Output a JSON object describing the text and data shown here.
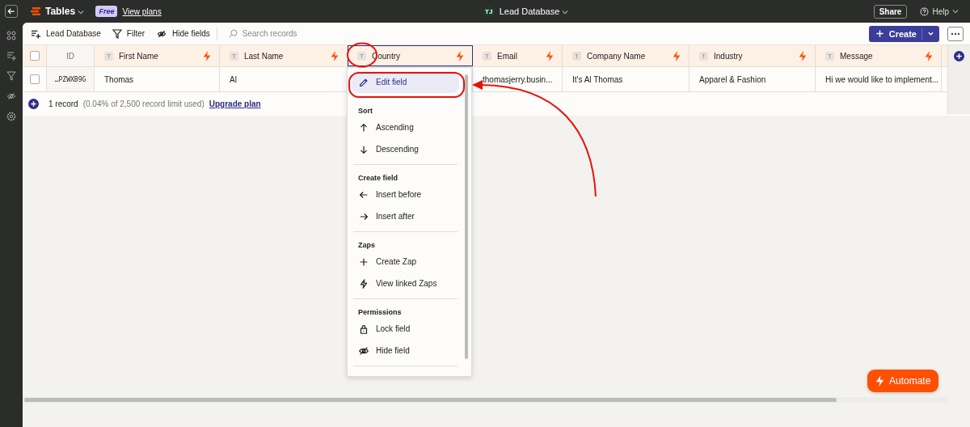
{
  "top_bar": {
    "app_name": "Tables",
    "plan_badge": "Free",
    "plan_link": "View plans",
    "avatar": "TJ",
    "table_name": "Lead Database",
    "share": "Share",
    "help": "Help"
  },
  "toolbar": {
    "table_button": "Lead Database",
    "filter": "Filter",
    "hide_fields": "Hide fields",
    "search": {
      "placeholder": "Search records"
    },
    "create": "Create"
  },
  "table": {
    "select_all_checked": false,
    "columns": [
      {
        "label": "ID",
        "kind": "id",
        "selected": false
      },
      {
        "label": "First Name",
        "kind": "text",
        "type_badge": "T",
        "selected": false
      },
      {
        "label": "Last Name",
        "kind": "text",
        "type_badge": "T",
        "selected": false
      },
      {
        "label": "Country",
        "kind": "text",
        "type_badge": "T",
        "selected": true
      },
      {
        "label": "Email",
        "kind": "text",
        "type_badge": "T",
        "selected": false
      },
      {
        "label": "Company Name",
        "kind": "text",
        "type_badge": "T",
        "selected": false
      },
      {
        "label": "Industry",
        "kind": "text",
        "type_badge": "T",
        "selected": false
      },
      {
        "label": "Message",
        "kind": "text",
        "type_badge": "T",
        "selected": false
      }
    ],
    "rows": [
      {
        "checked": false,
        "cells": [
          "…PZWXB9G",
          "Thomas",
          "Al",
          null,
          "thomasjerry.busin...",
          "It's Al Thomas",
          "Apparel & Fashion",
          "Hi we would like to implement..."
        ]
      }
    ]
  },
  "footer": {
    "count": "1 record",
    "limit_note": "(0.04% of 2,500 record limit used)",
    "upgrade_link": "Upgrade plan"
  },
  "column_menu": {
    "sections": [
      {
        "items": [
          {
            "label": "Edit field",
            "selected": true
          }
        ]
      },
      {
        "heading": "Sort",
        "items": [
          {
            "label": "Ascending",
            "selected": false
          },
          {
            "label": "Descending",
            "selected": false
          }
        ]
      },
      {
        "heading": "Create field",
        "items": [
          {
            "label": "Insert before",
            "selected": false
          },
          {
            "label": "Insert after",
            "selected": false
          }
        ]
      },
      {
        "heading": "Zaps",
        "items": [
          {
            "label": "Create Zap",
            "selected": false
          },
          {
            "label": "View linked Zaps",
            "selected": false
          }
        ]
      },
      {
        "heading": "Permissions",
        "items": [
          {
            "label": "Lock field",
            "selected": false
          },
          {
            "label": "Hide field",
            "selected": false
          }
        ]
      }
    ]
  },
  "automate_button": "Automate"
}
